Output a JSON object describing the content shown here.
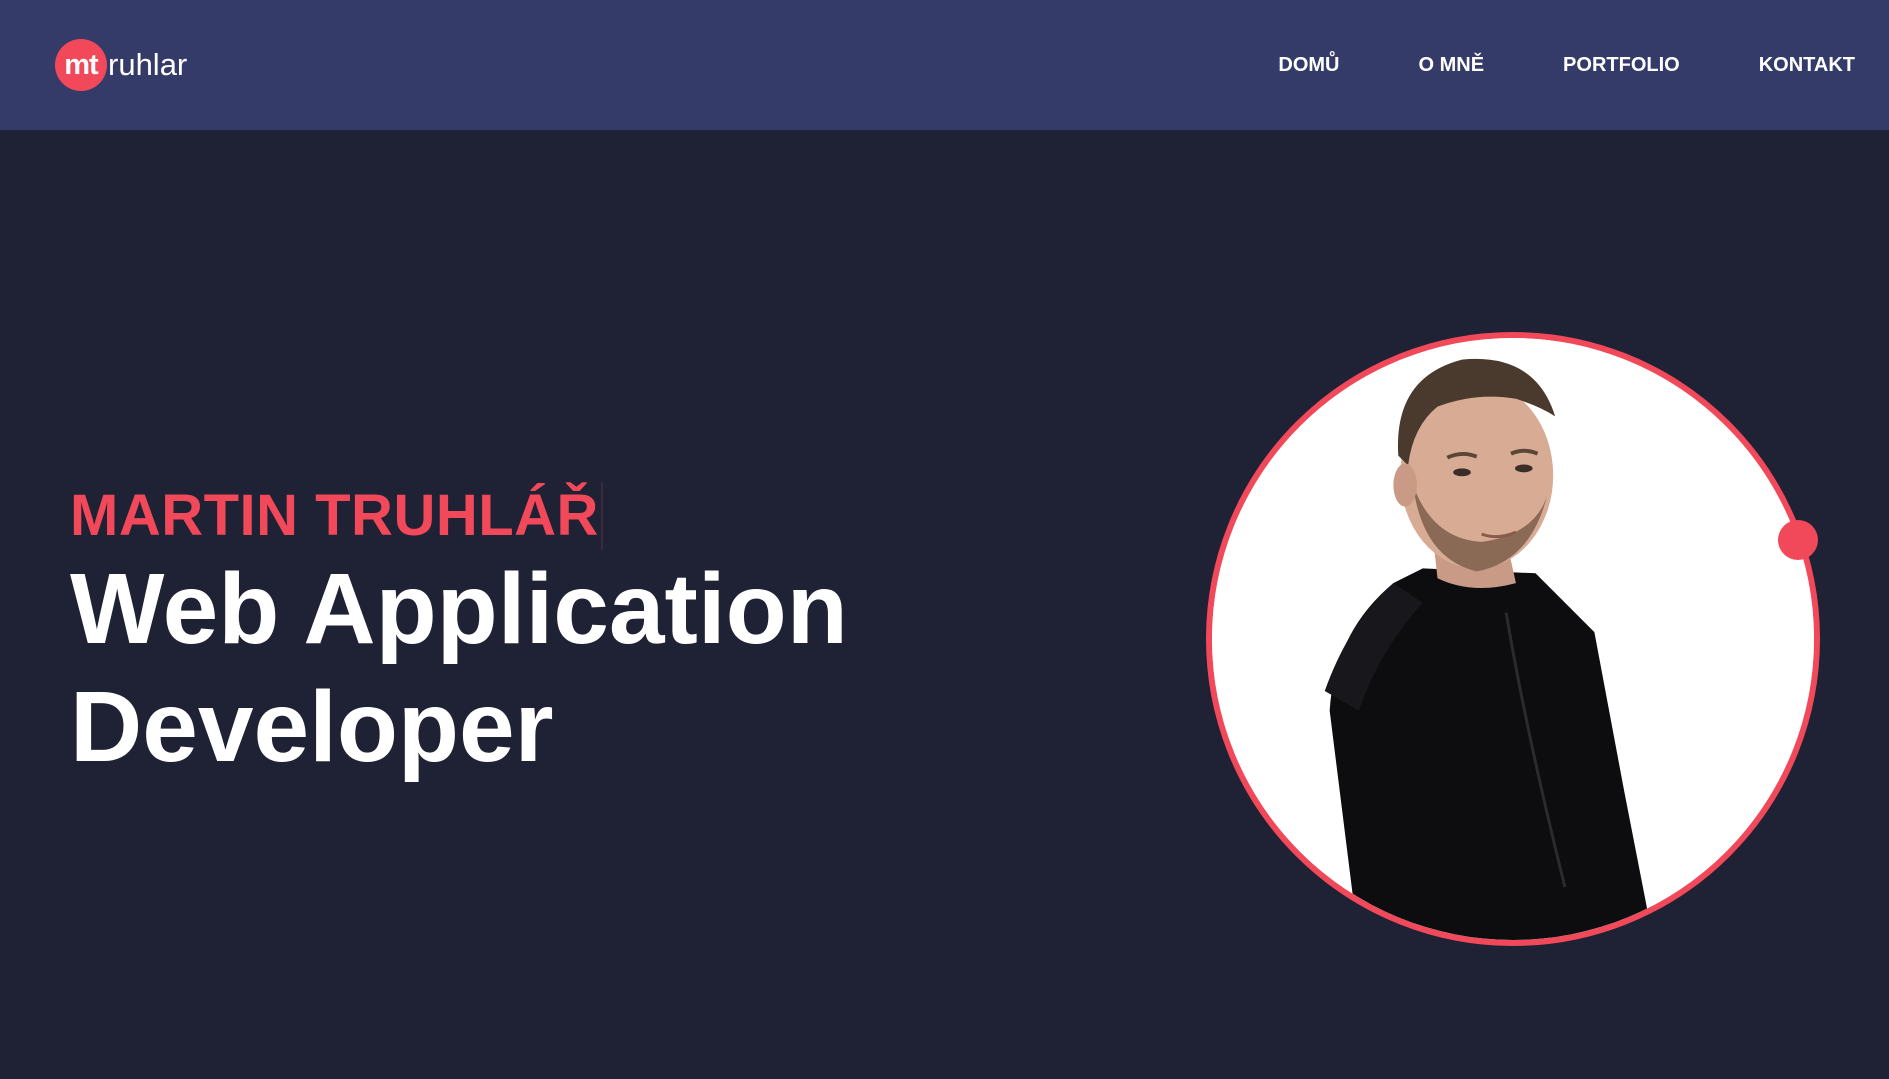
{
  "header": {
    "logo": {
      "badge": "mt",
      "text": "ruhlar"
    },
    "nav": [
      {
        "label": "DOMŮ"
      },
      {
        "label": "O MNĚ"
      },
      {
        "label": "PORTFOLIO"
      },
      {
        "label": "KONTAKT"
      }
    ]
  },
  "hero": {
    "name": "MARTIN TRUHLÁŘ",
    "title_line1": "Web Application",
    "title_line2": "Developer"
  },
  "colors": {
    "accent": "#f2495a",
    "header_bg": "#343b68",
    "page_bg": "#1f2135",
    "text": "#ffffff"
  },
  "portrait": {
    "icon": "person-photo"
  }
}
